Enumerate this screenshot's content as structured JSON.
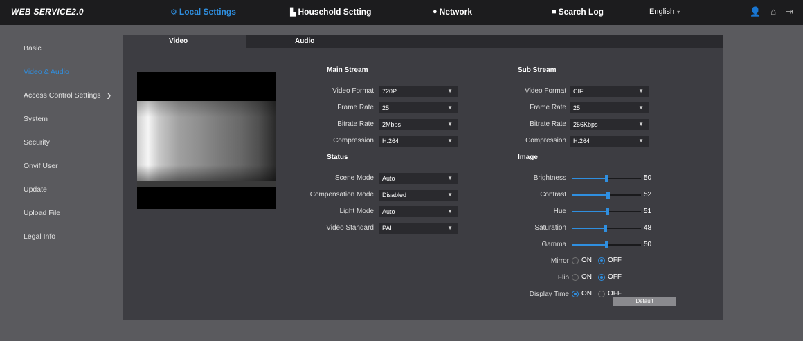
{
  "app": {
    "logo": "WEB SERVICE2.0"
  },
  "nav": [
    {
      "label": "Local Settings",
      "icon": "gear-icon",
      "active": true
    },
    {
      "label": "Household Setting",
      "icon": "building-icon",
      "active": false
    },
    {
      "label": "Network",
      "icon": "globe-icon",
      "active": false
    },
    {
      "label": "Search Log",
      "icon": "log-icon",
      "active": false
    }
  ],
  "language": "English",
  "top_icons": [
    "user-icon",
    "home-icon",
    "logout-icon"
  ],
  "sidebar": {
    "items": [
      {
        "label": "Basic"
      },
      {
        "label": "Video & Audio",
        "active": true
      },
      {
        "label": "Access Control Settings",
        "expandable": true
      },
      {
        "label": "System"
      },
      {
        "label": "Security"
      },
      {
        "label": "Onvif User"
      },
      {
        "label": "Update"
      },
      {
        "label": "Upload File"
      },
      {
        "label": "Legal Info"
      }
    ]
  },
  "tabs": [
    {
      "label": "Video",
      "active": true
    },
    {
      "label": "Audio",
      "active": false
    }
  ],
  "main_stream": {
    "title": "Main Stream",
    "fields": [
      {
        "label": "Video Format",
        "value": "720P"
      },
      {
        "label": "Frame Rate",
        "value": "25"
      },
      {
        "label": "Bitrate Rate",
        "value": "2Mbps"
      },
      {
        "label": "Compression",
        "value": "H.264"
      }
    ]
  },
  "sub_stream": {
    "title": "Sub Stream",
    "fields": [
      {
        "label": "Video Format",
        "value": "CIF"
      },
      {
        "label": "Frame Rate",
        "value": "25"
      },
      {
        "label": "Bitrate Rate",
        "value": "256Kbps"
      },
      {
        "label": "Compression",
        "value": "H.264"
      }
    ]
  },
  "status": {
    "title": "Status",
    "fields": [
      {
        "label": "Scene Mode",
        "value": "Auto"
      },
      {
        "label": "Compensation Mode",
        "value": "Disabled"
      },
      {
        "label": "Light Mode",
        "value": "Auto"
      },
      {
        "label": "Video Standard",
        "value": "PAL"
      }
    ]
  },
  "image": {
    "title": "Image",
    "sliders": [
      {
        "label": "Brightness",
        "value": "50",
        "level": 0.5
      },
      {
        "label": "Contrast",
        "value": "52",
        "level": 0.52
      },
      {
        "label": "Hue",
        "value": "51",
        "level": 0.51
      },
      {
        "label": "Saturation",
        "value": "48",
        "level": 0.48
      },
      {
        "label": "Gamma",
        "value": "50",
        "level": 0.5
      }
    ],
    "toggles": [
      {
        "label": "Mirror",
        "on": "ON",
        "off": "OFF",
        "selected": "OFF"
      },
      {
        "label": "Flip",
        "on": "ON",
        "off": "OFF",
        "selected": "OFF"
      },
      {
        "label": "Display Time",
        "on": "ON",
        "off": "OFF",
        "selected": "ON"
      }
    ],
    "default_label": "Default"
  },
  "colors": {
    "accent": "#2f8fe0",
    "topbar": "#1c1c1e",
    "panel": "#3d3d42",
    "background": "#5a5a5e"
  }
}
